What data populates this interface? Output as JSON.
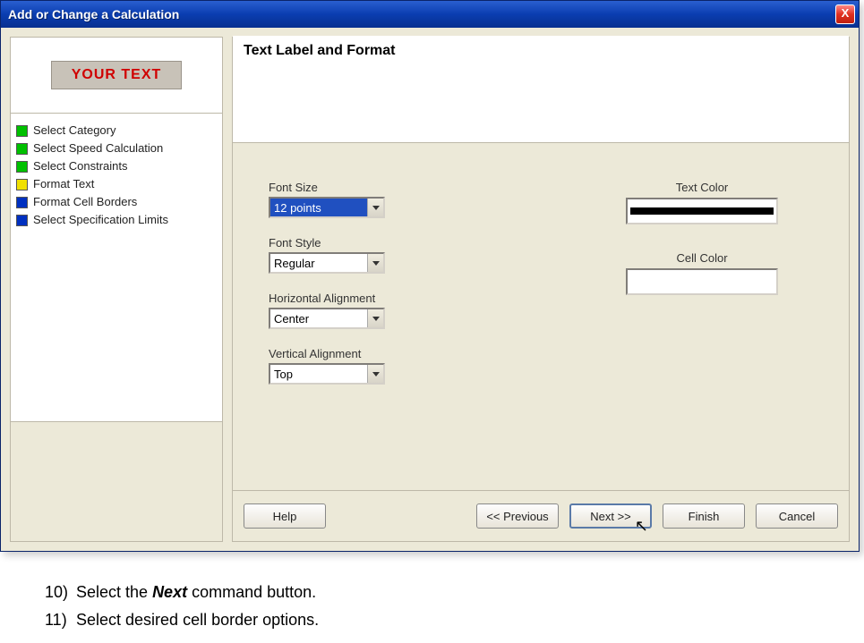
{
  "window": {
    "title": "Add or Change a Calculation",
    "close_label": "X"
  },
  "preview": {
    "text": "YOUR TEXT"
  },
  "steps": [
    {
      "color": "green",
      "label": "Select Category"
    },
    {
      "color": "green",
      "label": "Select Speed Calculation"
    },
    {
      "color": "green",
      "label": "Select Constraints"
    },
    {
      "color": "yellow",
      "label": "Format Text"
    },
    {
      "color": "blue",
      "label": "Format Cell Borders"
    },
    {
      "color": "blue",
      "label": "Select Specification Limits"
    }
  ],
  "section": {
    "heading": "Text Label and Format"
  },
  "form": {
    "font_size": {
      "label": "Font Size",
      "value": "12 points"
    },
    "font_style": {
      "label": "Font Style",
      "value": "Regular"
    },
    "h_align": {
      "label": "Horizontal Alignment",
      "value": "Center"
    },
    "v_align": {
      "label": "Vertical Alignment",
      "value": "Top"
    },
    "text_color": {
      "label": "Text Color",
      "value": "#000000"
    },
    "cell_color": {
      "label": "Cell Color",
      "value": ""
    }
  },
  "buttons": {
    "help": "Help",
    "prev": "<< Previous",
    "next": "Next >>",
    "finish": "Finish",
    "cancel": "Cancel"
  },
  "instructions": {
    "step10": {
      "pre": "Select the ",
      "em": "Next",
      "post": " command button."
    },
    "step11": "Select desired cell border options."
  }
}
